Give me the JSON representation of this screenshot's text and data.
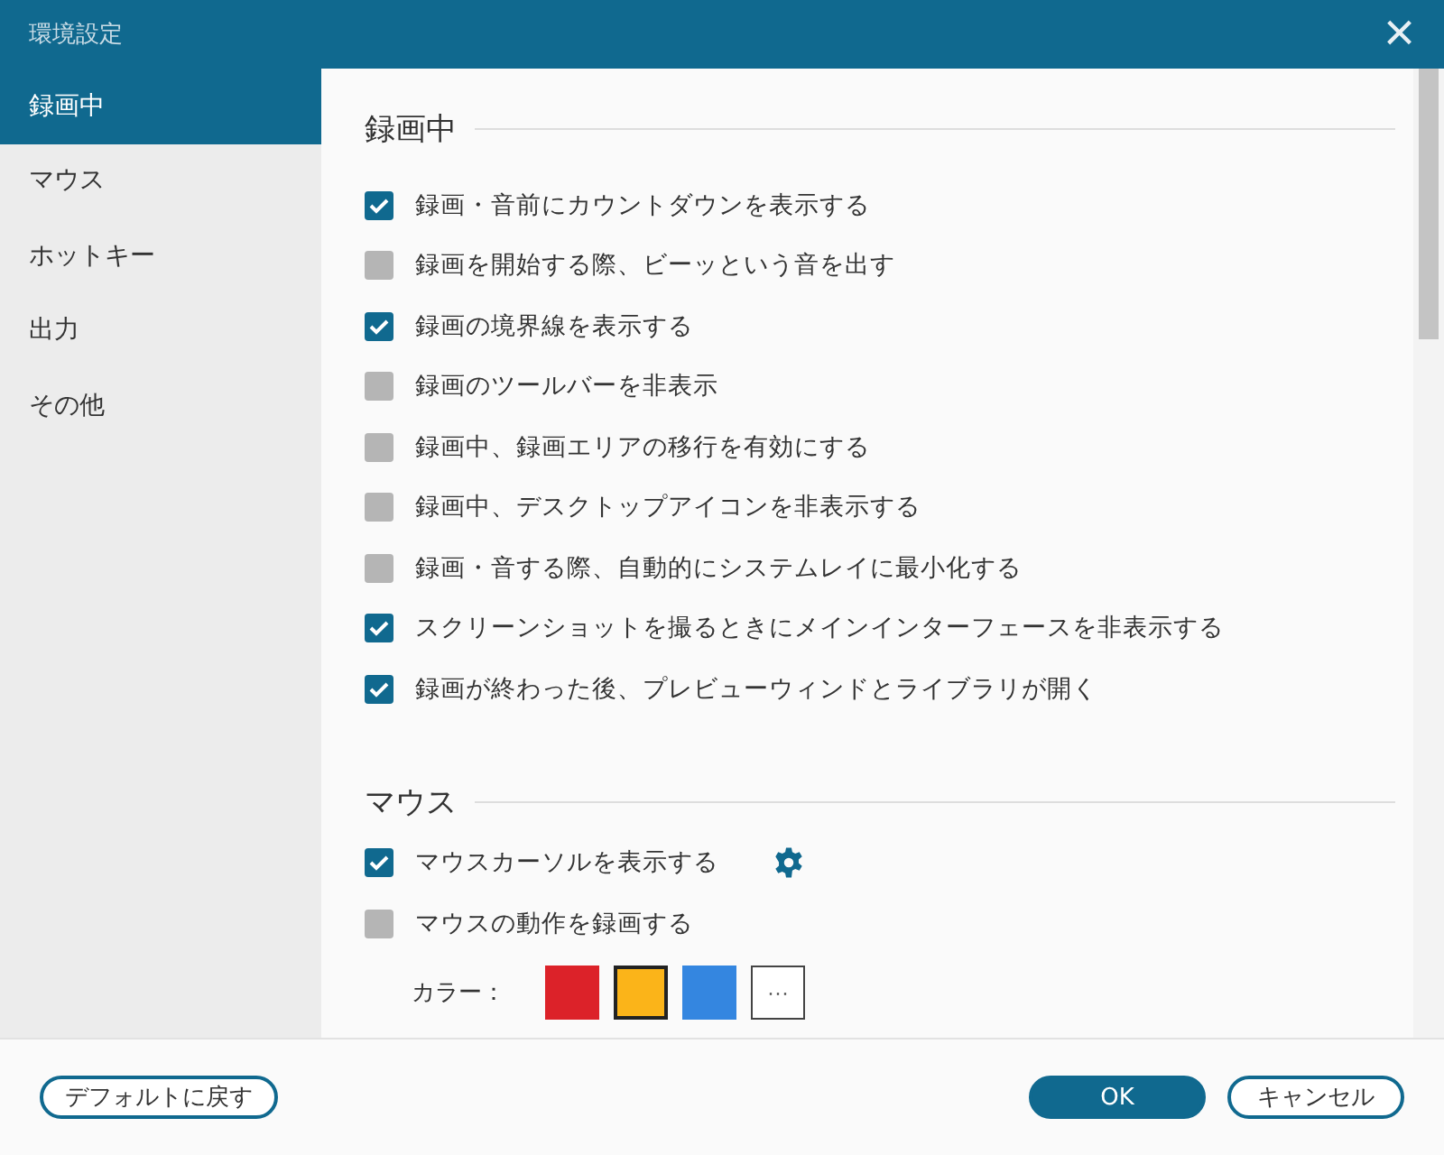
{
  "window": {
    "title": "環境設定",
    "close": "×"
  },
  "sidebar": {
    "items": [
      {
        "label": "録画中",
        "selected": true
      },
      {
        "label": "マウス",
        "selected": false
      },
      {
        "label": "ホットキー",
        "selected": false
      },
      {
        "label": "出力",
        "selected": false
      },
      {
        "label": "その他",
        "selected": false
      }
    ]
  },
  "sections": [
    {
      "title": "録画中",
      "options": [
        {
          "label": "録画・音前にカウントダウンを表示する",
          "checked": true
        },
        {
          "label": "録画を開始する際、ビーッという音を出す",
          "checked": false
        },
        {
          "label": "録画の境界線を表示する",
          "checked": true
        },
        {
          "label": "録画のツールバーを非表示",
          "checked": false
        },
        {
          "label": "録画中、録画エリアの移行を有効にする",
          "checked": false
        },
        {
          "label": "録画中、デスクトップアイコンを非表示する",
          "checked": false
        },
        {
          "label": "録画・音する際、自動的にシステムレイに最小化する",
          "checked": false
        },
        {
          "label": "スクリーンショットを撮るときにメインインターフェースを非表示する",
          "checked": true
        },
        {
          "label": "録画が終わった後、プレビューウィンドとライブラリが開く",
          "checked": true
        }
      ]
    },
    {
      "title": "マウス",
      "options": [
        {
          "label": "マウスカーソルを表示する",
          "checked": true,
          "settings": true
        },
        {
          "label": "マウスの動作を録画する",
          "checked": false
        }
      ],
      "color_row": {
        "label": "カラー：",
        "swatches": [
          {
            "color": "#dc2229",
            "selected": false
          },
          {
            "color": "#fbb419",
            "selected": true
          },
          {
            "color": "#3486e0",
            "selected": false
          }
        ],
        "more": "···"
      }
    }
  ],
  "footer": {
    "reset": "デフォルトに戻す",
    "ok": "OK",
    "cancel": "キャンセル"
  }
}
